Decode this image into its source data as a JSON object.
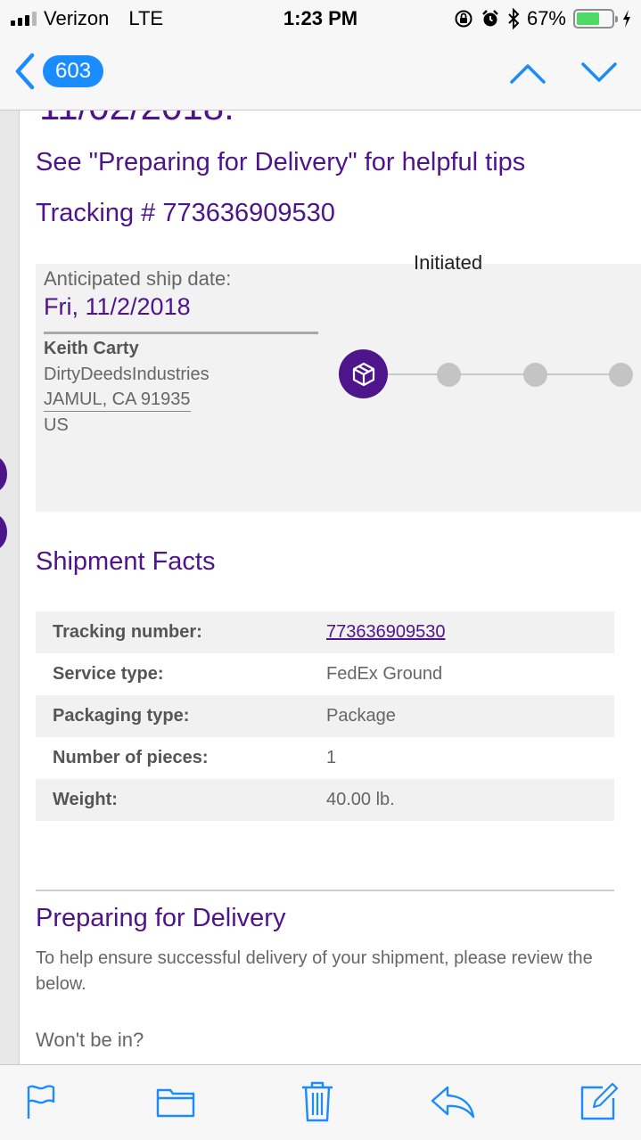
{
  "status_bar": {
    "carrier": "Verizon",
    "network": "LTE",
    "time": "1:23 PM",
    "battery_percent": "67%",
    "battery_level": 0.67
  },
  "nav": {
    "back_count": "603"
  },
  "email": {
    "cut_heading": "11/02/2018.",
    "preparing_link_line": "See \"Preparing for Delivery\" for helpful tips",
    "tracking_line": "Tracking # 773636909530",
    "shipment": {
      "anticipated_label": "Anticipated ship date:",
      "anticipated_date": "Fri, 11/2/2018",
      "recipient_name": "Keith Carty",
      "recipient_company": "DirtyDeedsIndustries",
      "recipient_city": "JAMUL, CA 91935",
      "recipient_country": "US",
      "progress_status": "Initiated"
    },
    "facts_title": "Shipment Facts",
    "facts": [
      {
        "key": "Tracking number:",
        "value": "773636909530"
      },
      {
        "key": "Service type:",
        "value": "FedEx Ground"
      },
      {
        "key": "Packaging type:",
        "value": "Package"
      },
      {
        "key": "Number of pieces:",
        "value": "1"
      },
      {
        "key": "Weight:",
        "value": "40.00 lb."
      }
    ],
    "prep_title": "Preparing for Delivery",
    "prep_text": "To help ensure successful delivery of your shipment, please review the below.",
    "wont_be_in": "Won't be in?"
  },
  "colors": {
    "accent": "#4d148c",
    "ios_blue": "#1a8cff",
    "battery_green": "#4cd964"
  },
  "icons": {
    "back": "chevron-left-icon",
    "prev": "chevron-up-icon",
    "next": "chevron-down-icon",
    "flag": "flag-icon",
    "folder": "folder-icon",
    "trash": "trash-icon",
    "reply": "reply-icon",
    "compose": "compose-icon",
    "package": "package-icon"
  }
}
